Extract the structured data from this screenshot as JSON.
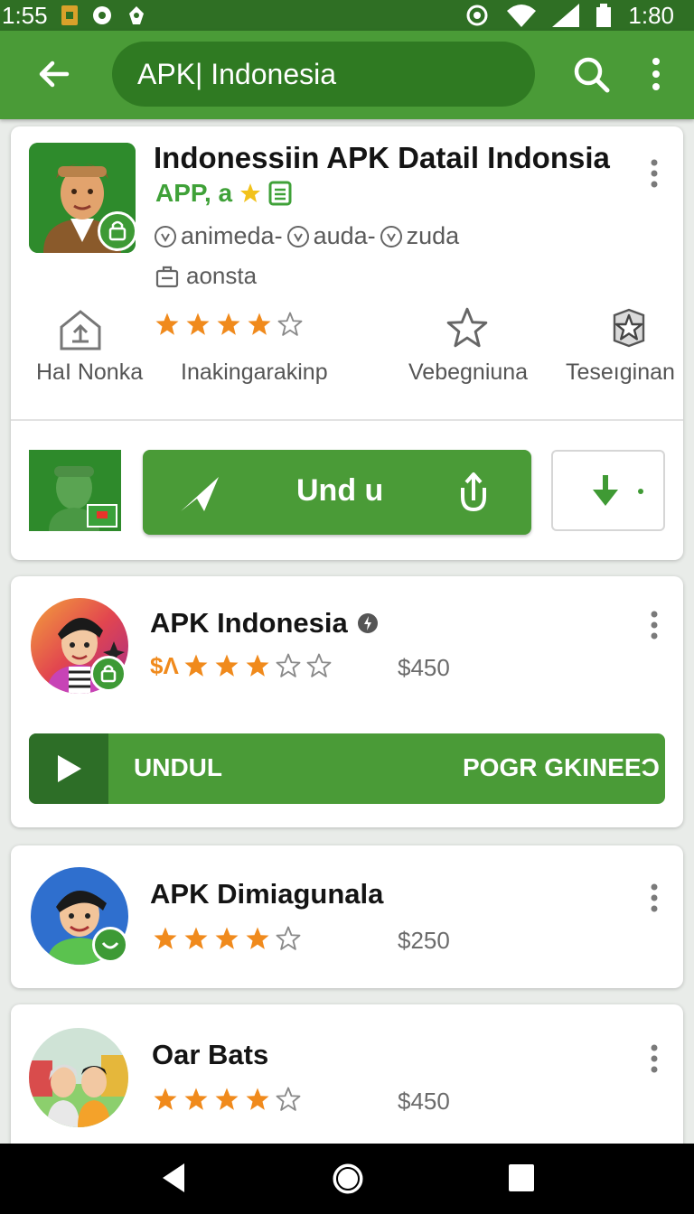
{
  "status_bar": {
    "time_left": "1:55",
    "time_right": "1:80",
    "icons_left": [
      "sim-icon",
      "location-icon",
      "notification-icon"
    ],
    "icons_right": [
      "sync-icon",
      "wifi-icon",
      "signal-icon",
      "battery-icon"
    ]
  },
  "app_bar": {
    "search_text": "APK| Indonesia",
    "color": "#4a9b37"
  },
  "featured": {
    "title": "Indonessiin APK Datail Indonsia",
    "subtitle": "APP, a",
    "developers": [
      "animeda-",
      "auda-",
      "zuda"
    ],
    "category": "aonsta",
    "rating_stars": 4,
    "stats": [
      {
        "icon": "home-upload-icon",
        "label": "HaІ Nonka"
      },
      {
        "icon": "rating-stars",
        "label": "Inakingarakinp"
      },
      {
        "icon": "star-outline-icon",
        "label": "Vebegniuna"
      },
      {
        "icon": "star-box-icon",
        "label": "Teseıginan"
      }
    ],
    "install_label": "Und u"
  },
  "apps": [
    {
      "name": "APK Indonesia",
      "price_prefix": "$Λ",
      "rating_stars": 3,
      "price": "$450",
      "progress_left": "UNDUL",
      "progress_right": "POGR GKINEEƆ"
    },
    {
      "name": "APK Dimiagunala",
      "rating_stars": 4,
      "price": "$250"
    },
    {
      "name": "Oar Bats",
      "rating_stars": 4,
      "price": "$450"
    }
  ],
  "colors": {
    "accent": "#4a9b37",
    "dark_accent": "#2f6f24",
    "star": "#f08a1c"
  }
}
